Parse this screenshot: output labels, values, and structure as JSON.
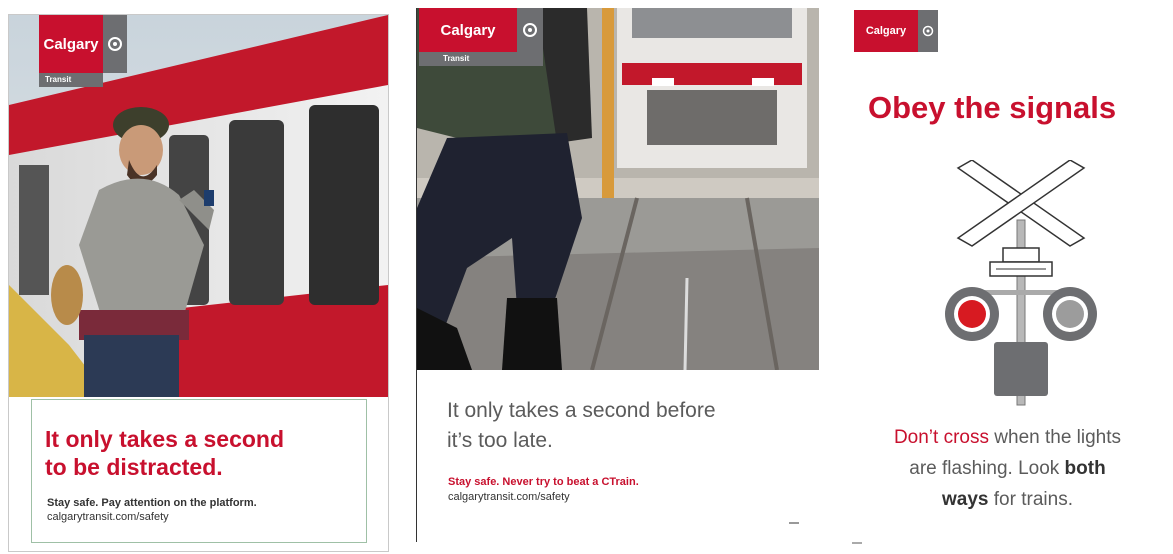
{
  "poster1": {
    "logo_text": "Calgary",
    "logo_sub": "Transit",
    "headline_line1": "It only takes a second",
    "headline_line2": "to be distracted.",
    "tagline": "Stay safe. Pay attention on the platform.",
    "url": "calgarytransit.com/safety"
  },
  "poster2": {
    "logo_text": "Calgary",
    "logo_sub": "Transit",
    "headline_line1": "It only takes a second before",
    "headline_line2": "it’s too late.",
    "tagline": "Stay safe. Never try to beat a CTrain.",
    "url": "calgarytransit.com/safety"
  },
  "poster3": {
    "logo_text": "Calgary",
    "headline": "Obey the signals",
    "body_dont": "Don’t ",
    "body_cross": "cross",
    "body_rest1": " when the lights",
    "body_line2a": "are flashing. Look ",
    "body_both": "both",
    "body_ways": "ways",
    "body_rest3": " for trains."
  },
  "colors": {
    "brand_red": "#c8102e",
    "brand_grey": "#6d6e71"
  },
  "icons": [
    "city-emblem-icon",
    "railway-crossing-signal-icon"
  ]
}
